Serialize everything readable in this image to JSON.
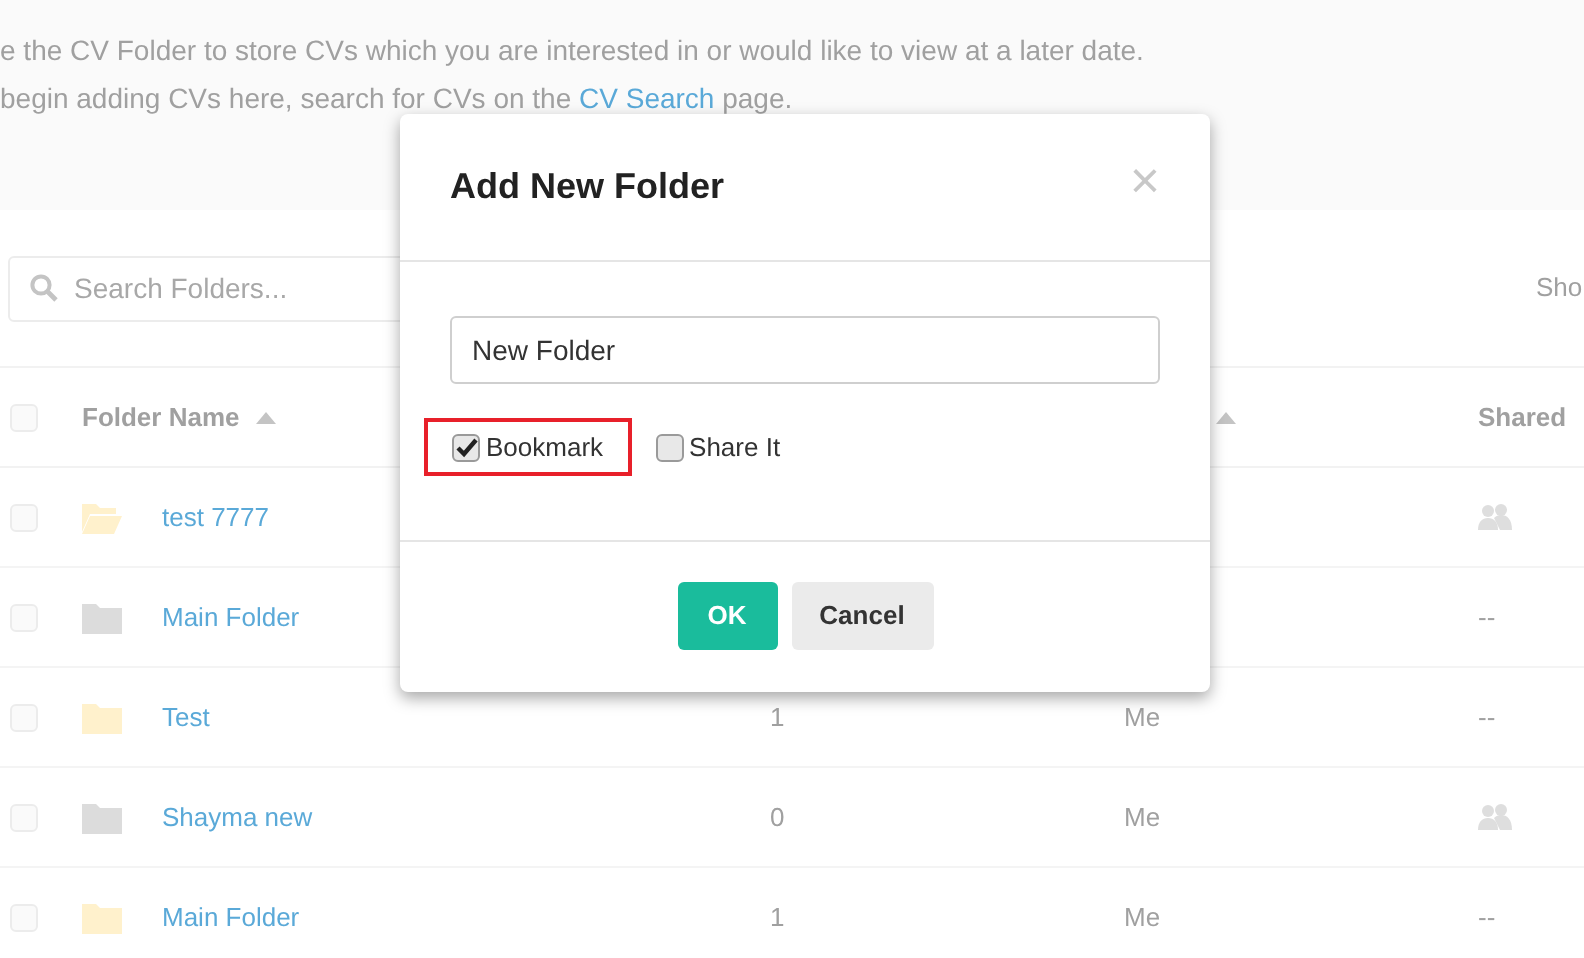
{
  "intro": {
    "line_1": "e the CV Folder to store CVs which you are interested in or would like to view at a later date.",
    "line_2_before": "begin adding CVs here, search for CVs on the ",
    "line_2_link": "CV Search",
    "line_2_after": " page."
  },
  "search": {
    "placeholder": "Search Folders..."
  },
  "show_label": "Sho",
  "table": {
    "select_all_checked": false,
    "columns": [
      {
        "label": "Folder Name",
        "sorted": true
      },
      {
        "sorted": true
      },
      {
        "label": "Shared",
        "sorted": false
      }
    ],
    "rows": [
      {
        "name": "test 7777",
        "count": "",
        "owner": "",
        "shared": {
          "kind": "icon"
        },
        "color": "#fff1cc",
        "open": true,
        "checked": false
      },
      {
        "name": "Main Folder",
        "count": "",
        "owner": "",
        "shared": {
          "kind": "text",
          "text": "--"
        },
        "color": "#dcdcdc",
        "open": false,
        "checked": false
      },
      {
        "name": "Test",
        "count": "1",
        "owner": "Me",
        "shared": {
          "kind": "text",
          "text": "--"
        },
        "color": "#fff1cc",
        "open": false,
        "checked": false
      },
      {
        "name": "Shayma new",
        "count": "0",
        "owner": "Me",
        "shared": {
          "kind": "icon"
        },
        "color": "#dcdcdc",
        "open": false,
        "checked": false
      },
      {
        "name": "Main Folder",
        "count": "1",
        "owner": "Me",
        "shared": {
          "kind": "text",
          "text": "--"
        },
        "color": "#fff1cc",
        "open": false,
        "checked": false
      }
    ]
  },
  "dialog": {
    "title": "Add New Folder",
    "close": "×",
    "name_value": "New Folder",
    "options": [
      {
        "label": "Bookmark",
        "checked": true,
        "highlighted": true
      },
      {
        "label": "Share It",
        "checked": false,
        "highlighted": false
      }
    ],
    "buttons": [
      {
        "label": "OK",
        "kind": "primary"
      },
      {
        "label": "Cancel",
        "kind": "secondary"
      }
    ]
  }
}
